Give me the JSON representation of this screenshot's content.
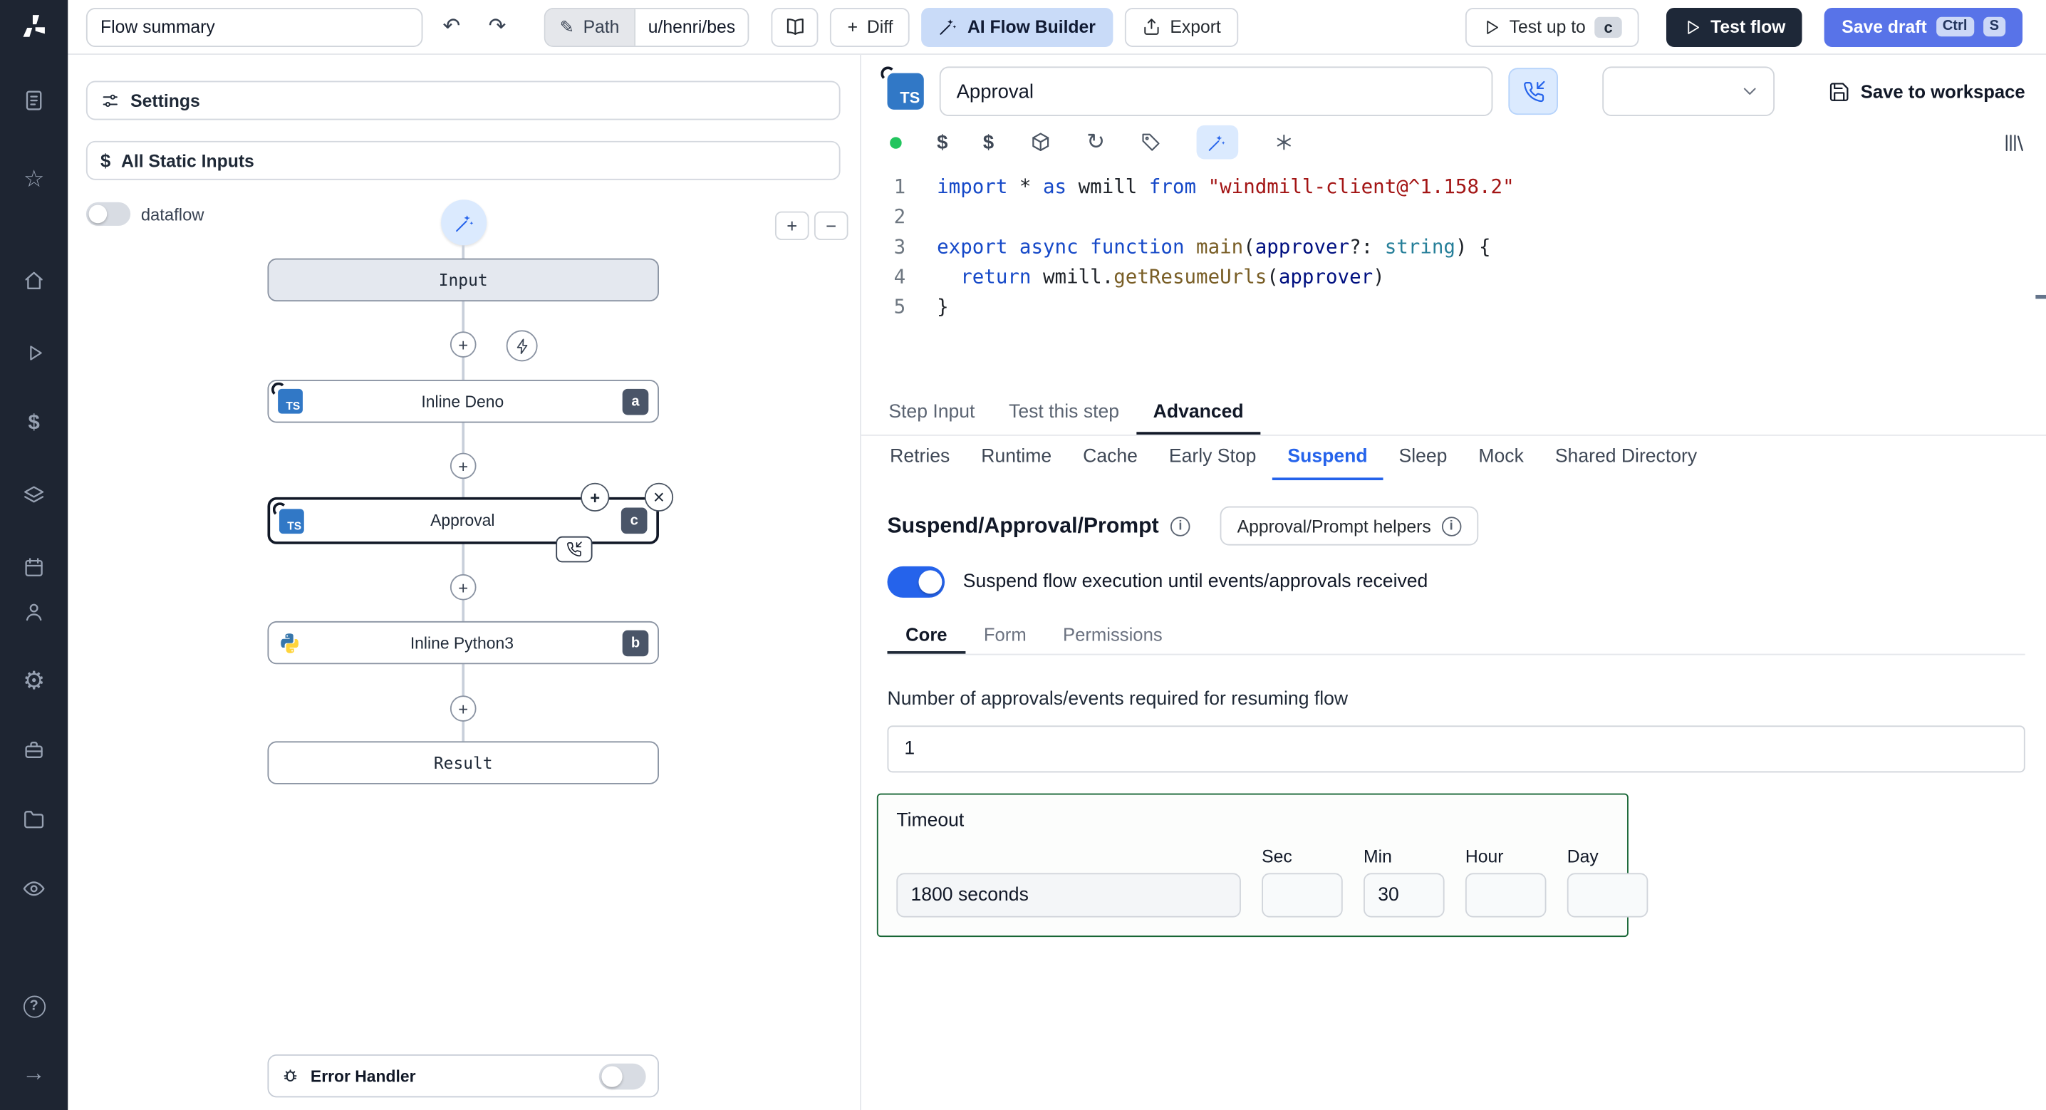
{
  "icons": {
    "undo": "↶",
    "redo": "↷",
    "pencil": "✎",
    "plus": "+",
    "minus": "−",
    "close": "×",
    "refresh": "↻",
    "dollar": "$",
    "info": "i",
    "question": "?",
    "ts": "TS",
    "gear": "⚙",
    "star": "☆",
    "arrow_right": "→"
  },
  "topbar": {
    "flow_summary": "Flow summary",
    "path": {
      "label": "Path",
      "value": "u/henri/bes"
    },
    "buttons": {
      "diff": "Diff",
      "ai": "AI Flow Builder",
      "export": "Export",
      "test_up_to": "Test up to",
      "test_up_to_badge": "c",
      "test_flow": "Test flow",
      "save_draft": "Save draft",
      "kbd_ctrl": "Ctrl",
      "kbd_s": "S"
    }
  },
  "flow": {
    "settings": "Settings",
    "static_inputs": "All Static Inputs",
    "dataflow": "dataflow",
    "nodes": {
      "input": "Input",
      "deno": {
        "label": "Inline Deno",
        "badge": "a"
      },
      "approval": {
        "label": "Approval",
        "badge": "c"
      },
      "python": {
        "label": "Inline Python3",
        "badge": "b"
      },
      "result": "Result"
    },
    "error_handler": "Error Handler"
  },
  "step": {
    "name": "Approval",
    "save_to_workspace": "Save to workspace",
    "tabs": [
      {
        "label": "Step Input"
      },
      {
        "label": "Test this step"
      },
      {
        "label": "Advanced"
      }
    ],
    "advanced_tabs": [
      "Retries",
      "Runtime",
      "Cache",
      "Early Stop",
      "Suspend",
      "Sleep",
      "Mock",
      "Shared Directory"
    ],
    "suspend": {
      "title": "Suspend/Approval/Prompt",
      "helpers": "Approval/Prompt helpers",
      "toggle_label": "Suspend flow execution until events/approvals received",
      "tabs": [
        "Core",
        "Form",
        "Permissions"
      ],
      "approvals_label": "Number of approvals/events required for resuming flow",
      "approvals_value": "1",
      "timeout": {
        "title": "Timeout",
        "display": "1800 seconds",
        "sec_label": "Sec",
        "min_label": "Min",
        "hour_label": "Hour",
        "day_label": "Day",
        "sec": "",
        "min": "30",
        "hour": "",
        "day": ""
      }
    }
  },
  "editor": {
    "lines": [
      {
        "n": "1",
        "toks": [
          [
            "kw",
            "import"
          ],
          [
            "pl",
            " * "
          ],
          [
            "kw",
            "as"
          ],
          [
            "pl",
            " wmill "
          ],
          [
            "kw",
            "from"
          ],
          [
            "pl",
            " "
          ],
          [
            "str",
            "\"windmill-client@^1.158.2\""
          ]
        ]
      },
      {
        "n": "2",
        "toks": []
      },
      {
        "n": "3",
        "toks": [
          [
            "kw",
            "export"
          ],
          [
            "pl",
            " "
          ],
          [
            "kw",
            "async"
          ],
          [
            "pl",
            " "
          ],
          [
            "kw",
            "function"
          ],
          [
            "pl",
            " "
          ],
          [
            "fn",
            "main"
          ],
          [
            "pl",
            "("
          ],
          [
            "var",
            "approver"
          ],
          [
            "pl",
            "?: "
          ],
          [
            "type",
            "string"
          ],
          [
            "pl",
            ") {"
          ]
        ]
      },
      {
        "n": "4",
        "toks": [
          [
            "pl",
            "  "
          ],
          [
            "kw",
            "return"
          ],
          [
            "pl",
            " wmill."
          ],
          [
            "fn",
            "getResumeUrls"
          ],
          [
            "pl",
            "("
          ],
          [
            "var",
            "approver"
          ],
          [
            "pl",
            ")"
          ]
        ]
      },
      {
        "n": "5",
        "toks": [
          [
            "pl",
            "}"
          ]
        ]
      }
    ]
  }
}
